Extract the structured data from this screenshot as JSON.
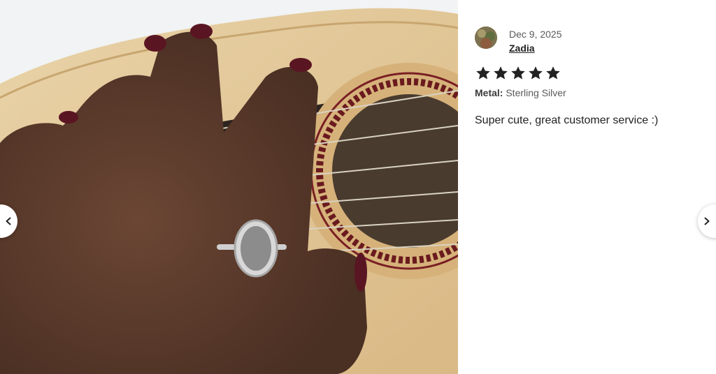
{
  "photo": {
    "icon": "review-photo-image",
    "alt_subject": "hand-with-ring-on-guitar"
  },
  "review": {
    "date": "Dec 9, 2025",
    "reviewer_name": "Zadia",
    "rating": 5,
    "rating_max": 5,
    "variation_label": "Metal:",
    "variation_value": "Sterling Silver",
    "text": "Super cute, great customer service :)"
  },
  "navigation": {
    "prev_icon": "chevron-left-icon",
    "next_icon": "chevron-right-icon"
  },
  "colors": {
    "star": "#222222",
    "text_primary": "#222222",
    "text_secondary": "#595959",
    "panel_background": "#ffffff"
  }
}
